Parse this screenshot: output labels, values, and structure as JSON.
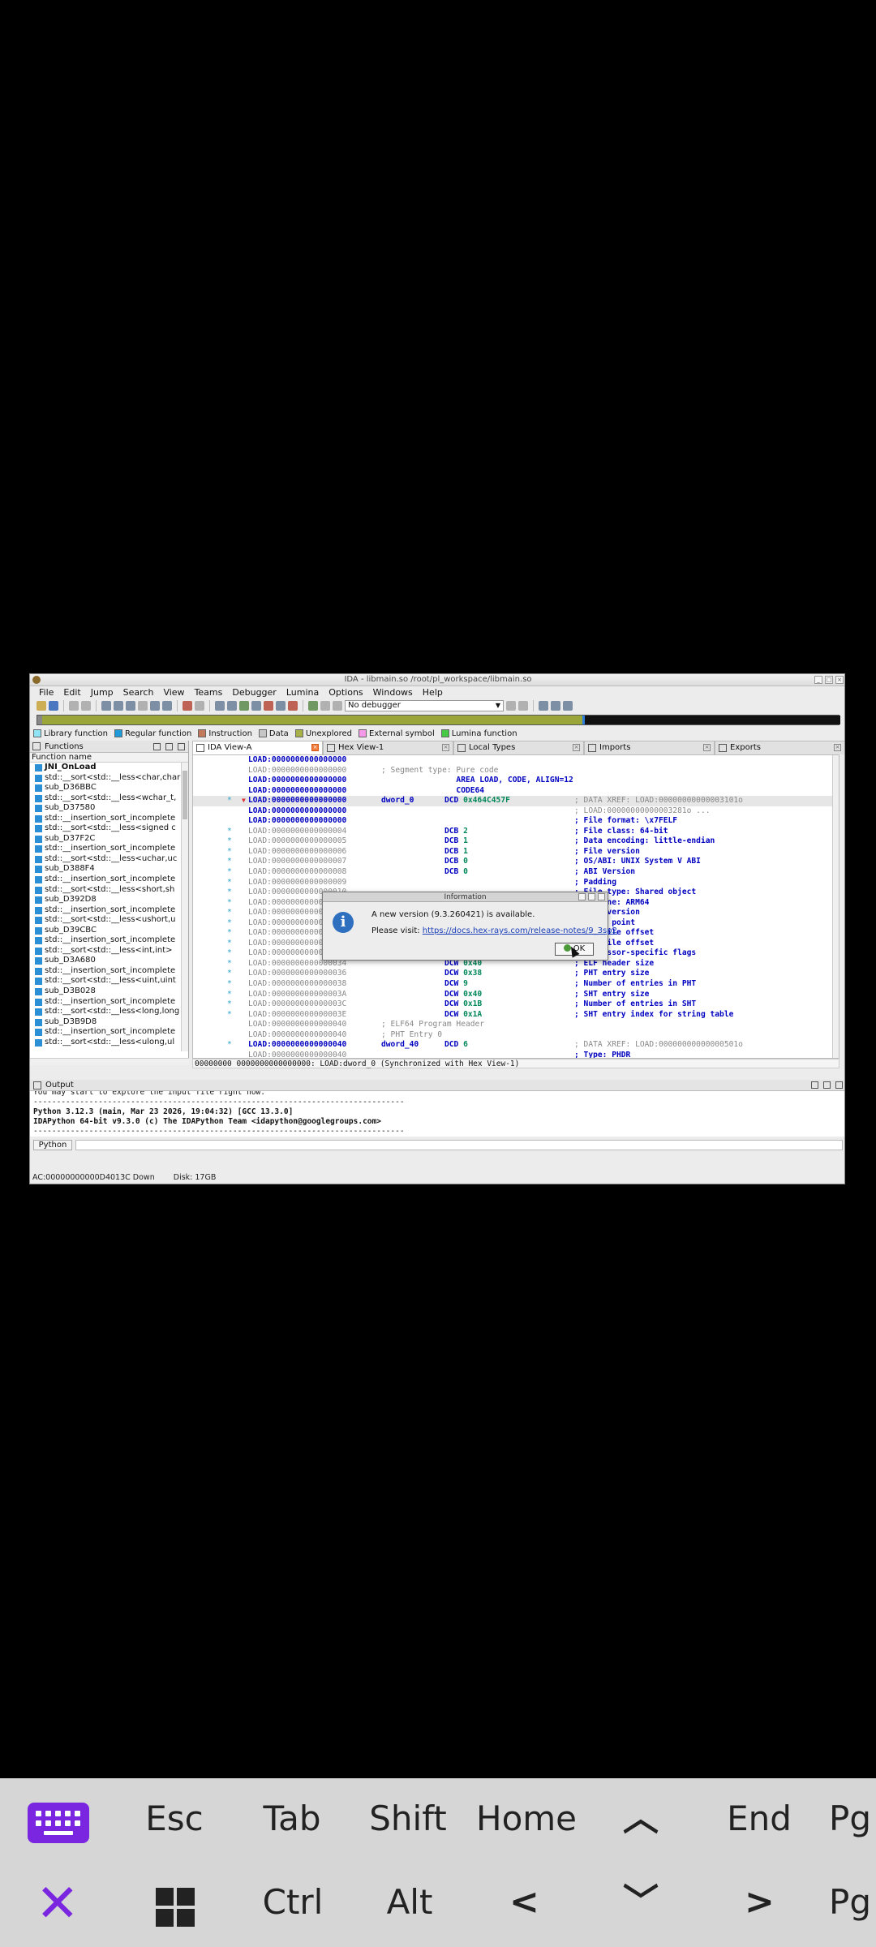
{
  "window": {
    "title": "IDA - libmain.so /root/pl_workspace/libmain.so"
  },
  "menu": [
    "File",
    "Edit",
    "Jump",
    "Search",
    "View",
    "Teams",
    "Debugger",
    "Lumina",
    "Options",
    "Windows",
    "Help"
  ],
  "toolbar": {
    "debugger_value": "No debugger"
  },
  "legend": [
    {
      "label": "Library function",
      "color": "#8fe3f5"
    },
    {
      "label": "Regular function",
      "color": "#1f9ad8"
    },
    {
      "label": "Instruction",
      "color": "#c2785a"
    },
    {
      "label": "Data",
      "color": "#c7c7c7"
    },
    {
      "label": "Unexplored",
      "color": "#a8b04a"
    },
    {
      "label": "External symbol",
      "color": "#f59ae9"
    },
    {
      "label": "Lumina function",
      "color": "#46c846"
    }
  ],
  "functions_panel": {
    "title": "Functions",
    "column": "Function name",
    "items": [
      "JNI_OnLoad",
      "std::__sort<std::__less<char,char",
      "sub_D36BBC",
      "std::__sort<std::__less<wchar_t,",
      "sub_D37580",
      "std::__insertion_sort_incomplete",
      "std::__sort<std::__less<signed c",
      "sub_D37F2C",
      "std::__insertion_sort_incomplete",
      "std::__sort<std::__less<uchar,uc",
      "sub_D388F4",
      "std::__insertion_sort_incomplete",
      "std::__sort<std::__less<short,sh",
      "sub_D392D8",
      "std::__insertion_sort_incomplete",
      "std::__sort<std::__less<ushort,u",
      "sub_D39CBC",
      "std::__insertion_sort_incomplete",
      "std::__sort<std::__less<int,int>",
      "sub_D3A680",
      "std::__insertion_sort_incomplete",
      "std::__sort<std::__less<uint,uint",
      "sub_D3B028",
      "std::__insertion_sort_incomplete",
      "std::__sort<std::__less<long,long",
      "sub_D3B9D8",
      "std::__insertion_sort_incomplete",
      "std::__sort<std::__less<ulong,ul"
    ]
  },
  "tabs": [
    "IDA View-A",
    "Hex View-1",
    "Local Types",
    "Imports",
    "Exports"
  ],
  "disasm": [
    {
      "addr": "LOAD:0000000000000000",
      "code": ""
    },
    {
      "addr": "LOAD:0000000000000000",
      "code": "; Segment type: Pure code",
      "g": true
    },
    {
      "addr": "LOAD:0000000000000000",
      "code": "                AREA LOAD, CODE, ALIGN=12"
    },
    {
      "addr": "LOAD:0000000000000000",
      "code": "                CODE64"
    },
    {
      "addr": "LOAD:0000000000000000",
      "label": "dword_0",
      "ins": "DCD",
      "op": "0x464C457F",
      "cmt": "; DATA XREF: LOAD:00000000000003101o",
      "cg": true,
      "hl": true,
      "star": true,
      "arrow": true
    },
    {
      "addr": "LOAD:0000000000000000",
      "cmt": "; LOAD:00000000000003281o ...",
      "cg": true
    },
    {
      "addr": "LOAD:0000000000000000",
      "cmt": "; File format: \\x7FELF"
    },
    {
      "addr": "LOAD:0000000000000004",
      "ins": "DCB",
      "op": "2",
      "cmt": "; File class: 64-bit",
      "g": true,
      "star": true
    },
    {
      "addr": "LOAD:0000000000000005",
      "ins": "DCB",
      "op": "1",
      "cmt": "; Data encoding: little-endian",
      "g": true,
      "star": true
    },
    {
      "addr": "LOAD:0000000000000006",
      "ins": "DCB",
      "op": "1",
      "cmt": "; File version",
      "g": true,
      "star": true
    },
    {
      "addr": "LOAD:0000000000000007",
      "ins": "DCB",
      "op": "0",
      "cmt": "; OS/ABI: UNIX System V ABI",
      "g": true,
      "star": true
    },
    {
      "addr": "LOAD:0000000000000008",
      "ins": "DCB",
      "op": "0",
      "cmt": "; ABI Version",
      "g": true,
      "star": true
    },
    {
      "addr": "LOAD:0000000000000009",
      "cmt": "; Padding",
      "g": true,
      "star": true
    },
    {
      "addr": "LOAD:0000000000000010",
      "cmt": "; File type: Shared object",
      "g": true,
      "star": true
    },
    {
      "addr": "LOAD:0000000000000012",
      "cmt": "; Machine: ARM64",
      "g": true,
      "star": true
    },
    {
      "addr": "LOAD:0000000000000014",
      "cmt": "; File version",
      "g": true,
      "star": true
    },
    {
      "addr": "LOAD:0000000000000018",
      "cmt": "; Entry point",
      "g": true,
      "star": true
    },
    {
      "addr": "LOAD:0000000000000020",
      "cmt": "; PHT file offset",
      "g": true,
      "star": true
    },
    {
      "addr": "LOAD:0000000000000028",
      "cmt": "; SHT file offset",
      "g": true,
      "star": true
    },
    {
      "addr": "LOAD:0000000000000030",
      "ins": "DCD",
      "op": "0",
      "cmt": "; Processor-specific flags",
      "g": true,
      "star": true
    },
    {
      "addr": "LOAD:0000000000000034",
      "ins": "DCW",
      "op": "0x40",
      "cmt": "; ELF header size",
      "g": true,
      "star": true
    },
    {
      "addr": "LOAD:0000000000000036",
      "ins": "DCW",
      "op": "0x38",
      "cmt": "; PHT entry size",
      "g": true,
      "star": true
    },
    {
      "addr": "LOAD:0000000000000038",
      "ins": "DCW",
      "op": "9",
      "cmt": "; Number of entries in PHT",
      "g": true,
      "star": true
    },
    {
      "addr": "LOAD:000000000000003A",
      "ins": "DCW",
      "op": "0x40",
      "cmt": "; SHT entry size",
      "g": true,
      "star": true
    },
    {
      "addr": "LOAD:000000000000003C",
      "ins": "DCW",
      "op": "0x1B",
      "cmt": "; Number of entries in SHT",
      "g": true,
      "star": true
    },
    {
      "addr": "LOAD:000000000000003E",
      "ins": "DCW",
      "op": "0x1A",
      "cmt": "; SHT entry index for string table",
      "g": true,
      "star": true
    },
    {
      "addr": "LOAD:0000000000000040",
      "code": "; ELF64 Program Header",
      "g": true
    },
    {
      "addr": "LOAD:0000000000000040",
      "code": "; PHT Entry 0",
      "g": true
    },
    {
      "addr": "LOAD:0000000000000040",
      "label": "dword_40",
      "ins": "DCD",
      "op": "6",
      "cmt": "; DATA XREF: LOAD:00000000000000501o",
      "cg": true,
      "star": true
    },
    {
      "addr": "LOAD:0000000000000040",
      "cmt": "; Type: PHDR",
      "g": true
    }
  ],
  "disasm_status": "00000000 0000000000000000: LOAD:dword_0 (Synchronized with Hex View-1)",
  "output": {
    "title": "Output",
    "lines": [
      "You may start to explore the input file right now.",
      "--------------------------------------------------------------------------------",
      "Python 3.12.3 (main, Mar 23 2026, 19:04:32) [GCC 13.3.0]",
      "IDAPython 64-bit v9.3.0 (c) The IDAPython Team <idapython@googlegroups.com>",
      "--------------------------------------------------------------------------------"
    ],
    "python_button": "Python"
  },
  "statusbar": {
    "ac": "AC:00000000000D4013C Down",
    "disk": "Disk: 17GB"
  },
  "dialog": {
    "title": "Information",
    "message": "A new version (9.3.260421) is available.",
    "visit_prefix": "Please visit: ",
    "link": "https://docs.hex-rays.com/release-notes/9_3sp2",
    "ok": "OK"
  },
  "keyboard": {
    "row1": [
      "Esc",
      "Tab",
      "Shift",
      "Home",
      "End",
      "Pg"
    ],
    "row2": [
      "Ctrl",
      "Alt",
      "Pg"
    ]
  }
}
